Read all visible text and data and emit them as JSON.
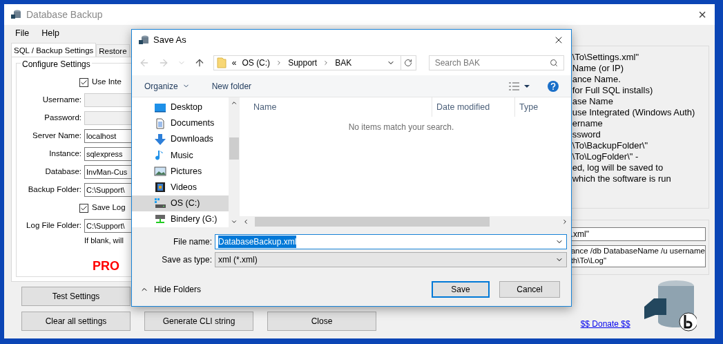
{
  "window": {
    "title": "Database Backup",
    "close": "×"
  },
  "menu": [
    "File",
    "Help"
  ],
  "tabs": [
    {
      "label": "SQL / Backup Settings",
      "selected": true
    },
    {
      "label": "Restore",
      "selected": false
    }
  ],
  "configure": {
    "title": "Configure Settings",
    "rows": [
      {
        "kind": "checkbox",
        "label": "Use Inte",
        "checked": true
      },
      {
        "kind": "field",
        "label": "Username:",
        "disabled": true
      },
      {
        "kind": "field",
        "label": "Password:",
        "disabled": true
      },
      {
        "kind": "field",
        "label": "Server Name:",
        "value": "localhost",
        "disabled": false
      },
      {
        "kind": "field",
        "label": "Instance:",
        "value": "sqlexpress",
        "disabled": false
      },
      {
        "kind": "field",
        "label": "Database:",
        "value": "InvMan-Cus",
        "disabled": false
      },
      {
        "kind": "field",
        "label": "Backup Folder:",
        "value": "C:\\Support\\",
        "disabled": false
      },
      {
        "kind": "checkbox",
        "label": "Save Log",
        "checked": true
      },
      {
        "kind": "field",
        "label": "Log File Folder:",
        "value": "C:\\Support\\",
        "disabled": false
      },
      {
        "kind": "note",
        "label": "If blank, will"
      }
    ],
    "badge": "PRO"
  },
  "buttons_row1": [
    "Test Settings"
  ],
  "buttons_row2": [
    "Clear all settings",
    "Generate CLI string",
    "Close"
  ],
  "help_lines": [
    "\\To\\Settings.xml\"",
    "Name (or IP)",
    "ance Name.",
    "for Full SQL installs)",
    "ase Name",
    "use Integrated (Windows Auth)",
    "ername",
    "ssword",
    "\\To\\BackupFolder\\\"",
    "\\To\\LogFolder\\\" -",
    "ed, log will be saved to",
    "which the software is run"
  ],
  "cli_fields": [
    ".xml\"",
    "ance /db DatabaseName /u username\nth\\To\\Log\""
  ],
  "donate_link": "$$ Donate $$",
  "dialog": {
    "title": "Save As",
    "address": [
      "«",
      "OS (C:)",
      "Support",
      "BAK"
    ],
    "search_placeholder": "Search BAK",
    "toolbar": [
      "Organize",
      "New folder"
    ],
    "nav_items": [
      {
        "label": "Desktop",
        "kind": "desktop",
        "selected": false
      },
      {
        "label": "Documents",
        "kind": "documents",
        "selected": false
      },
      {
        "label": "Downloads",
        "kind": "downloads",
        "selected": false
      },
      {
        "label": "Music",
        "kind": "music",
        "selected": false
      },
      {
        "label": "Pictures",
        "kind": "pictures",
        "selected": false
      },
      {
        "label": "Videos",
        "kind": "videos",
        "selected": false
      },
      {
        "label": "OS (C:)",
        "kind": "drive",
        "selected": true
      },
      {
        "label": "Bindery (G:)",
        "kind": "network",
        "selected": false
      }
    ],
    "columns": [
      "Name",
      "Date modified",
      "Type"
    ],
    "empty_message": "No items match your search.",
    "file_name_label": "File name:",
    "file_name": "DatabaseBackup.xml",
    "type_label": "Save as type:",
    "type_value": "xml (*.xml)",
    "hide_folders": "Hide Folders",
    "buttons": [
      "Save",
      "Cancel"
    ]
  }
}
